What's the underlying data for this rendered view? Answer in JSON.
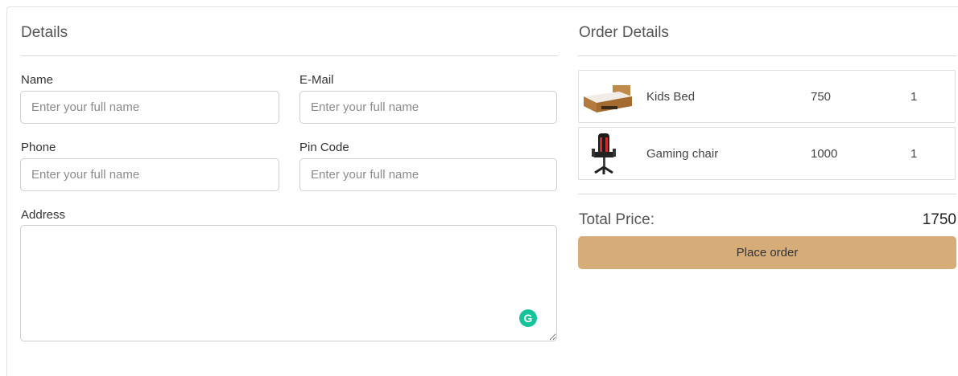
{
  "details": {
    "title": "Details",
    "name_label": "Name",
    "name_placeholder": "Enter your full name",
    "email_label": "E-Mail",
    "email_placeholder": "Enter your full name",
    "phone_label": "Phone",
    "phone_placeholder": "Enter your full name",
    "pincode_label": "Pin Code",
    "pincode_placeholder": "Enter your full name",
    "address_label": "Address",
    "grammarly_icon": "G"
  },
  "order": {
    "title": "Order Details",
    "items": [
      {
        "name": "Kids Bed",
        "price": "750",
        "qty": "1",
        "icon": "bed-image"
      },
      {
        "name": "Gaming chair",
        "price": "1000",
        "qty": "1",
        "icon": "gaming-chair-image"
      }
    ],
    "total_label": "Total Price:",
    "total_value": "1750",
    "place_order_label": "Place order"
  },
  "colors": {
    "button": "#d6ac79",
    "grammarly": "#15c39a",
    "border": "#cfcfcf"
  }
}
